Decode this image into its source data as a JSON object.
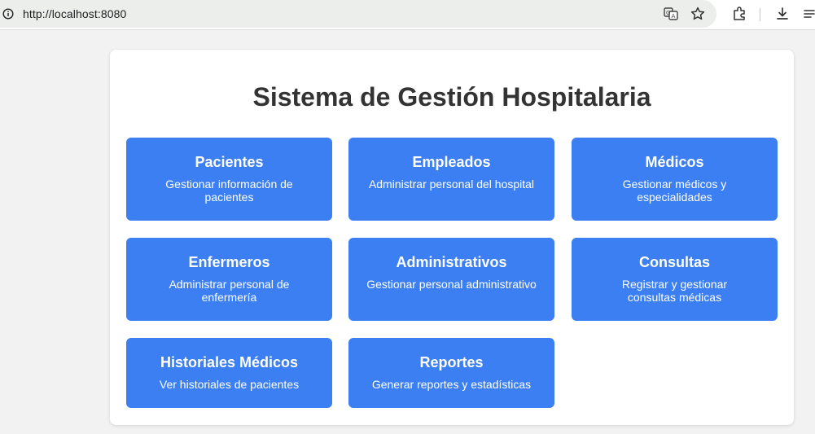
{
  "browser": {
    "url": "http://localhost:8080",
    "icons": [
      "info-icon",
      "translate-icon",
      "star-icon",
      "extensions-icon",
      "download-icon",
      "menu-icon"
    ]
  },
  "colors": {
    "tile_background": "#3b7ff2",
    "title_text": "#333333",
    "page_background": "#f2f2f2"
  },
  "main": {
    "title": "Sistema de Gestión Hospitalaria",
    "modules": [
      {
        "title": "Pacientes",
        "description": "Gestionar información de pacientes"
      },
      {
        "title": "Empleados",
        "description": "Administrar personal del hospital"
      },
      {
        "title": "Médicos",
        "description": "Gestionar médicos y especialidades"
      },
      {
        "title": "Enfermeros",
        "description": "Administrar personal de enfermería"
      },
      {
        "title": "Administrativos",
        "description": "Gestionar personal administrativo"
      },
      {
        "title": "Consultas",
        "description": "Registrar y gestionar consultas médicas"
      },
      {
        "title": "Historiales Médicos",
        "description": "Ver historiales de pacientes"
      },
      {
        "title": "Reportes",
        "description": "Generar reportes y estadísticas"
      }
    ]
  }
}
